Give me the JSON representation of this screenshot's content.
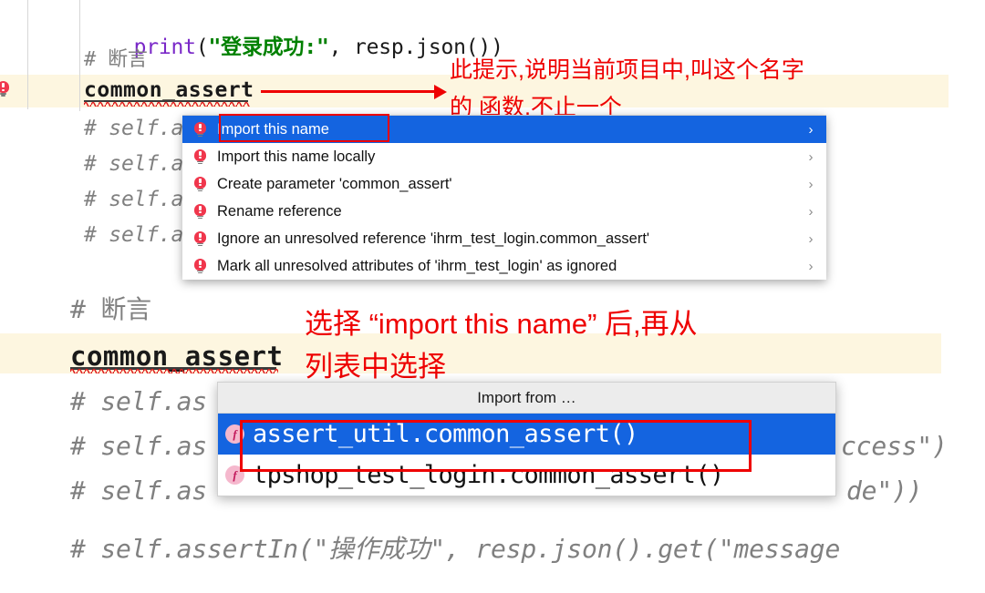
{
  "editor": {
    "top_lines": [
      {
        "type": "code",
        "segments": [
          {
            "text": "print",
            "cls": "tok-kw"
          },
          {
            "text": "(",
            "cls": "tok-pl"
          },
          {
            "text": "\"登录成功:\"",
            "cls": "tok-str"
          },
          {
            "text": ", resp.json())",
            "cls": "tok-pl"
          }
        ]
      },
      {
        "type": "comment",
        "text": "# 断言"
      },
      {
        "type": "plain",
        "text": "common_assert"
      },
      {
        "type": "comment",
        "text": "# self.a"
      },
      {
        "type": "comment",
        "text": "# self.a"
      },
      {
        "type": "comment",
        "text": "# self.a"
      },
      {
        "type": "comment",
        "text": "# self.a"
      }
    ],
    "bottom_lines": [
      {
        "type": "comment",
        "text": "# 断言"
      },
      {
        "type": "plain",
        "text": "common_assert"
      },
      {
        "type": "comment",
        "text": "# self.as"
      },
      {
        "type": "comment",
        "text": "# self.as"
      },
      {
        "type": "comment",
        "text": "# self.as"
      },
      {
        "type": "comment",
        "text": "# self.assertIn(\"操作成功\", resp.json().get(\"message"
      }
    ],
    "clipped_right": [
      {
        "text": "ccess\")"
      },
      {
        "text": "de\"))"
      }
    ]
  },
  "intention_menu": {
    "items": [
      {
        "label": "Import this name",
        "selected": true,
        "chevron": "›"
      },
      {
        "label": "Import this name locally",
        "selected": false,
        "chevron": "›"
      },
      {
        "label": "Create parameter 'common_assert'",
        "selected": false,
        "chevron": "›"
      },
      {
        "label": "Rename reference",
        "selected": false,
        "chevron": "›"
      },
      {
        "label": "Ignore an unresolved reference 'ihrm_test_login.common_assert'",
        "selected": false,
        "chevron": "›"
      },
      {
        "label": "Mark all unresolved attributes of 'ihrm_test_login' as ignored",
        "selected": false,
        "chevron": "›"
      }
    ]
  },
  "import_popup": {
    "title": "Import from …",
    "rows": [
      {
        "badge": "f",
        "text": "assert_util.common_assert()",
        "selected": true
      },
      {
        "badge": "f",
        "text": "tpshop_test_login.common_assert()",
        "selected": false
      }
    ]
  },
  "annotations": {
    "top_note_line1": "此提示,说明当前项目中,叫这个名字",
    "top_note_line2": "的 函数,不止一个",
    "mid_note_line1": "选择 “import this name” 后,再从",
    "mid_note_line2": "列表中选择"
  },
  "colors": {
    "accent_blue": "#1464e0",
    "annotation_red": "#ee0000",
    "highlight_band": "#fdf6e0",
    "comment_gray": "#808080",
    "string_green": "#008000",
    "keyword_purple": "#7a28c8",
    "bulb_red": "#f0364c"
  }
}
